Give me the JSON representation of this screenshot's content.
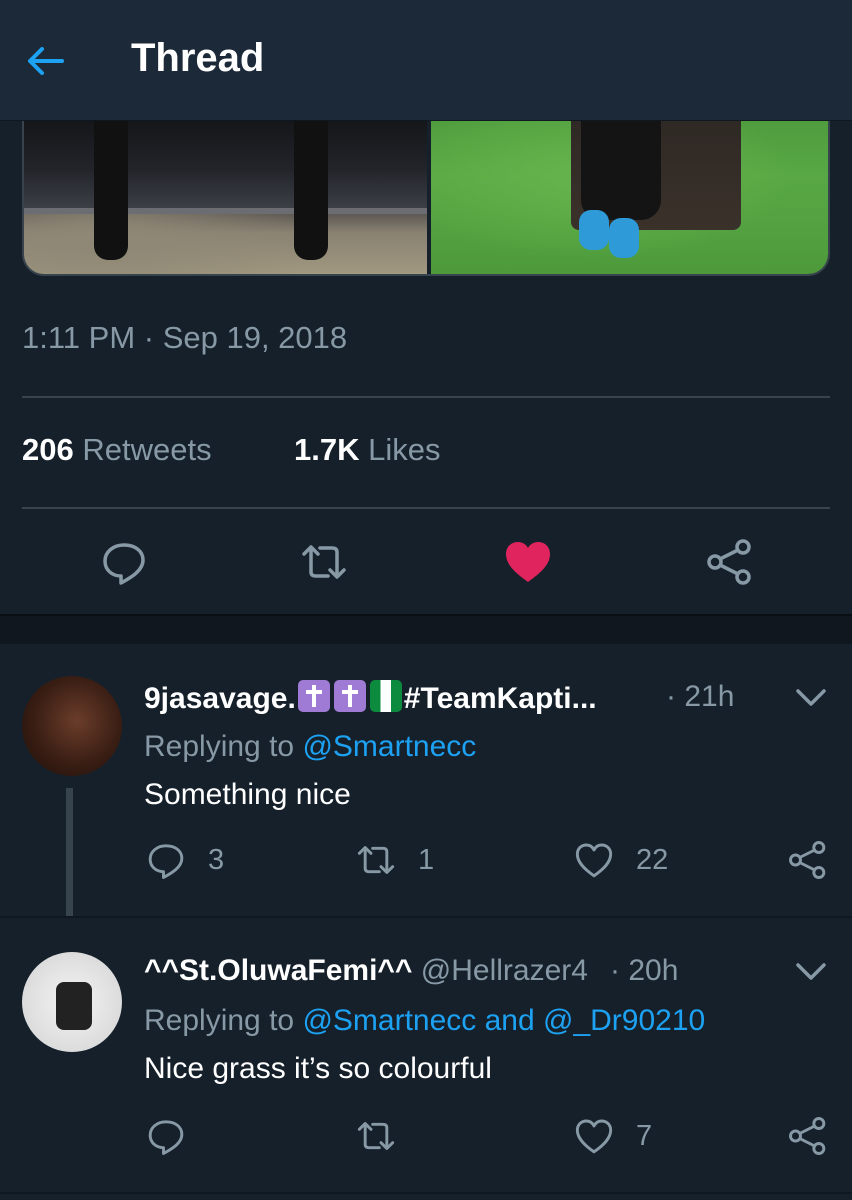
{
  "header": {
    "title": "Thread"
  },
  "tweet": {
    "timestamp": "1:11 PM · Sep 19, 2018",
    "retweets_count": "206",
    "retweets_label": "Retweets",
    "likes_count": "1.7K",
    "likes_label": "Likes",
    "liked": true,
    "like_color": "#e0245e"
  },
  "replies": [
    {
      "name": "9jasavage.",
      "name_suffix": "#TeamKapti...",
      "handle": "",
      "time": "· 21h",
      "replying_prefix": "Replying to",
      "replying_to": "@Smartnecc",
      "text": "Something nice",
      "reply_count": "3",
      "retweet_count": "1",
      "like_count": "22"
    },
    {
      "name": "^^St.OluwaFemi^^",
      "handle": "@Hellrazer4",
      "time": "· 20h",
      "replying_prefix": "Replying to",
      "replying_to": "@Smartnecc and @_Dr90210",
      "text": "Nice grass it’s so colourful",
      "reply_count": "",
      "retweet_count": "",
      "like_count": "7"
    }
  ],
  "colors": {
    "background": "#15202b",
    "header": "#1c2938",
    "accent": "#1da1f2",
    "muted": "#8899a6",
    "like": "#e0245e"
  }
}
